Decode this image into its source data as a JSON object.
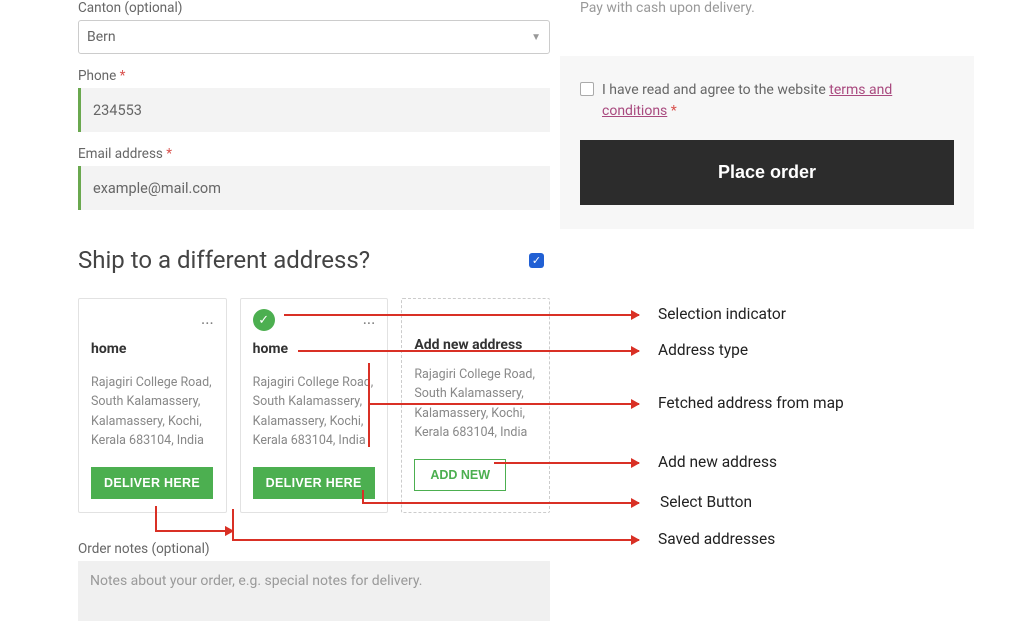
{
  "form": {
    "canton_label": "Canton (optional)",
    "canton_value": "Bern",
    "phone_label": "Phone",
    "phone_value": "234553",
    "email_label": "Email address",
    "email_value": "example@mail.com"
  },
  "ship": {
    "heading": "Ship to a different address?",
    "checked": true
  },
  "cards": {
    "card1": {
      "type": "home",
      "address": "Rajagiri College Road, South Kalamassery, Kalamassery, Kochi, Kerala 683104, India",
      "button": "DELIVER HERE"
    },
    "card2": {
      "type": "home",
      "address": "Rajagiri College Road, South Kalamassery, Kalamassery, Kochi, Kerala 683104, India",
      "button": "DELIVER HERE",
      "selected": true
    },
    "card3": {
      "title": "Add new address",
      "address": "Rajagiri College Road, South Kalamassery, Kalamassery, Kochi, Kerala 683104, India",
      "button": "ADD NEW"
    }
  },
  "order_notes": {
    "label": "Order notes (optional)",
    "placeholder": "Notes about your order, e.g. special notes for delivery."
  },
  "right": {
    "pay_note": "Pay with cash upon delivery.",
    "consent_prefix": "I have read and agree to the website ",
    "tc_link": "terms and conditions",
    "place_order": "Place order"
  },
  "annotations": {
    "a1": "Selection indicator",
    "a2": "Address type",
    "a3": "Fetched address from map",
    "a4": "Add new address",
    "a5": "Select Button",
    "a6": "Saved addresses"
  }
}
